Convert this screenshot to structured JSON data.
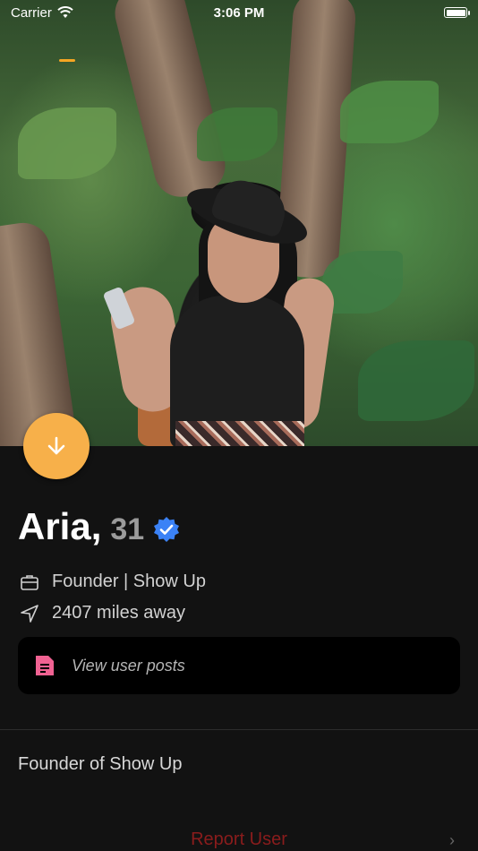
{
  "status_bar": {
    "carrier": "Carrier",
    "time": "3:06 PM"
  },
  "photo": {
    "alt_description": "profile photo"
  },
  "profile": {
    "name": "Aria,",
    "age": "31",
    "verified": true,
    "job": "Founder | Show Up",
    "distance": "2407 miles away",
    "bio": "Founder of Show Up"
  },
  "actions": {
    "view_posts_label": "View user posts",
    "report_label": "Report User"
  },
  "colors": {
    "accent": "#f7b04a",
    "verified_blue": "#3b82f6",
    "posts_icon_pink": "#f06292",
    "report_red": "#8a1c1c",
    "background": "#121212"
  },
  "icons": {
    "down_button": "arrow-down-icon",
    "job": "briefcase-icon",
    "distance": "location-arrow-icon",
    "posts": "document-icon",
    "verified": "verified-badge-icon",
    "report_chevron": "chevron-right-icon"
  }
}
